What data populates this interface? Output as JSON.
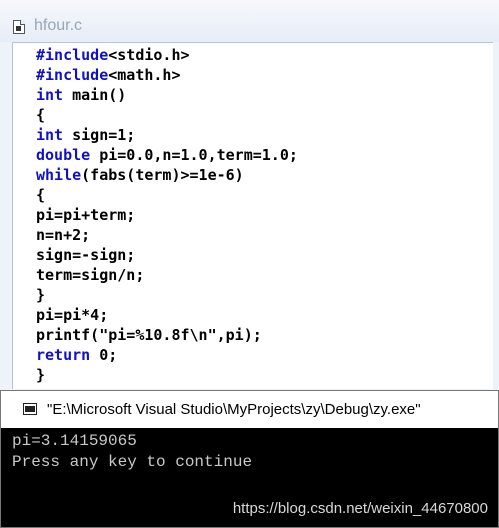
{
  "editor": {
    "tab_title": "hfour.c",
    "file_icon": "c-source-file-icon",
    "lines": [
      [
        {
          "t": "#include",
          "k": true
        },
        {
          "t": "<stdio.h>",
          "k": false
        }
      ],
      [
        {
          "t": "#include",
          "k": true
        },
        {
          "t": "<math.h>",
          "k": false
        }
      ],
      [
        {
          "t": "int",
          "k": true
        },
        {
          "t": " main()",
          "k": false
        }
      ],
      [
        {
          "t": "{",
          "k": false
        }
      ],
      [
        {
          "t": "int",
          "k": true
        },
        {
          "t": " sign=1;",
          "k": false
        }
      ],
      [
        {
          "t": "double",
          "k": true
        },
        {
          "t": " pi=0.0,n=1.0,term=1.0;",
          "k": false
        }
      ],
      [
        {
          "t": "while",
          "k": true
        },
        {
          "t": "(fabs(term)>=1e-6)",
          "k": false
        }
      ],
      [
        {
          "t": "{",
          "k": false
        }
      ],
      [
        {
          "t": "pi=pi+term;",
          "k": false
        }
      ],
      [
        {
          "t": "n=n+2;",
          "k": false
        }
      ],
      [
        {
          "t": "sign=-sign;",
          "k": false
        }
      ],
      [
        {
          "t": "term=sign/n;",
          "k": false
        }
      ],
      [
        {
          "t": "}",
          "k": false
        }
      ],
      [
        {
          "t": "pi=pi*4;",
          "k": false
        }
      ],
      [
        {
          "t": "printf(\"pi=%10.8f\\n\",pi);",
          "k": false
        }
      ],
      [
        {
          "t": "return",
          "k": true
        },
        {
          "t": " 0;",
          "k": false
        }
      ],
      [
        {
          "t": "}",
          "k": false
        }
      ]
    ],
    "keyword_color": "#1010c8"
  },
  "console": {
    "title": "\"E:\\Microsoft Visual Studio\\MyProjects\\zy\\Debug\\zy.exe\"",
    "icon": "console-window-icon",
    "output_lines": [
      "pi=3.14159065",
      "Press any key to continue"
    ]
  },
  "watermark": "https://blog.csdn.net/weixin_44670800"
}
